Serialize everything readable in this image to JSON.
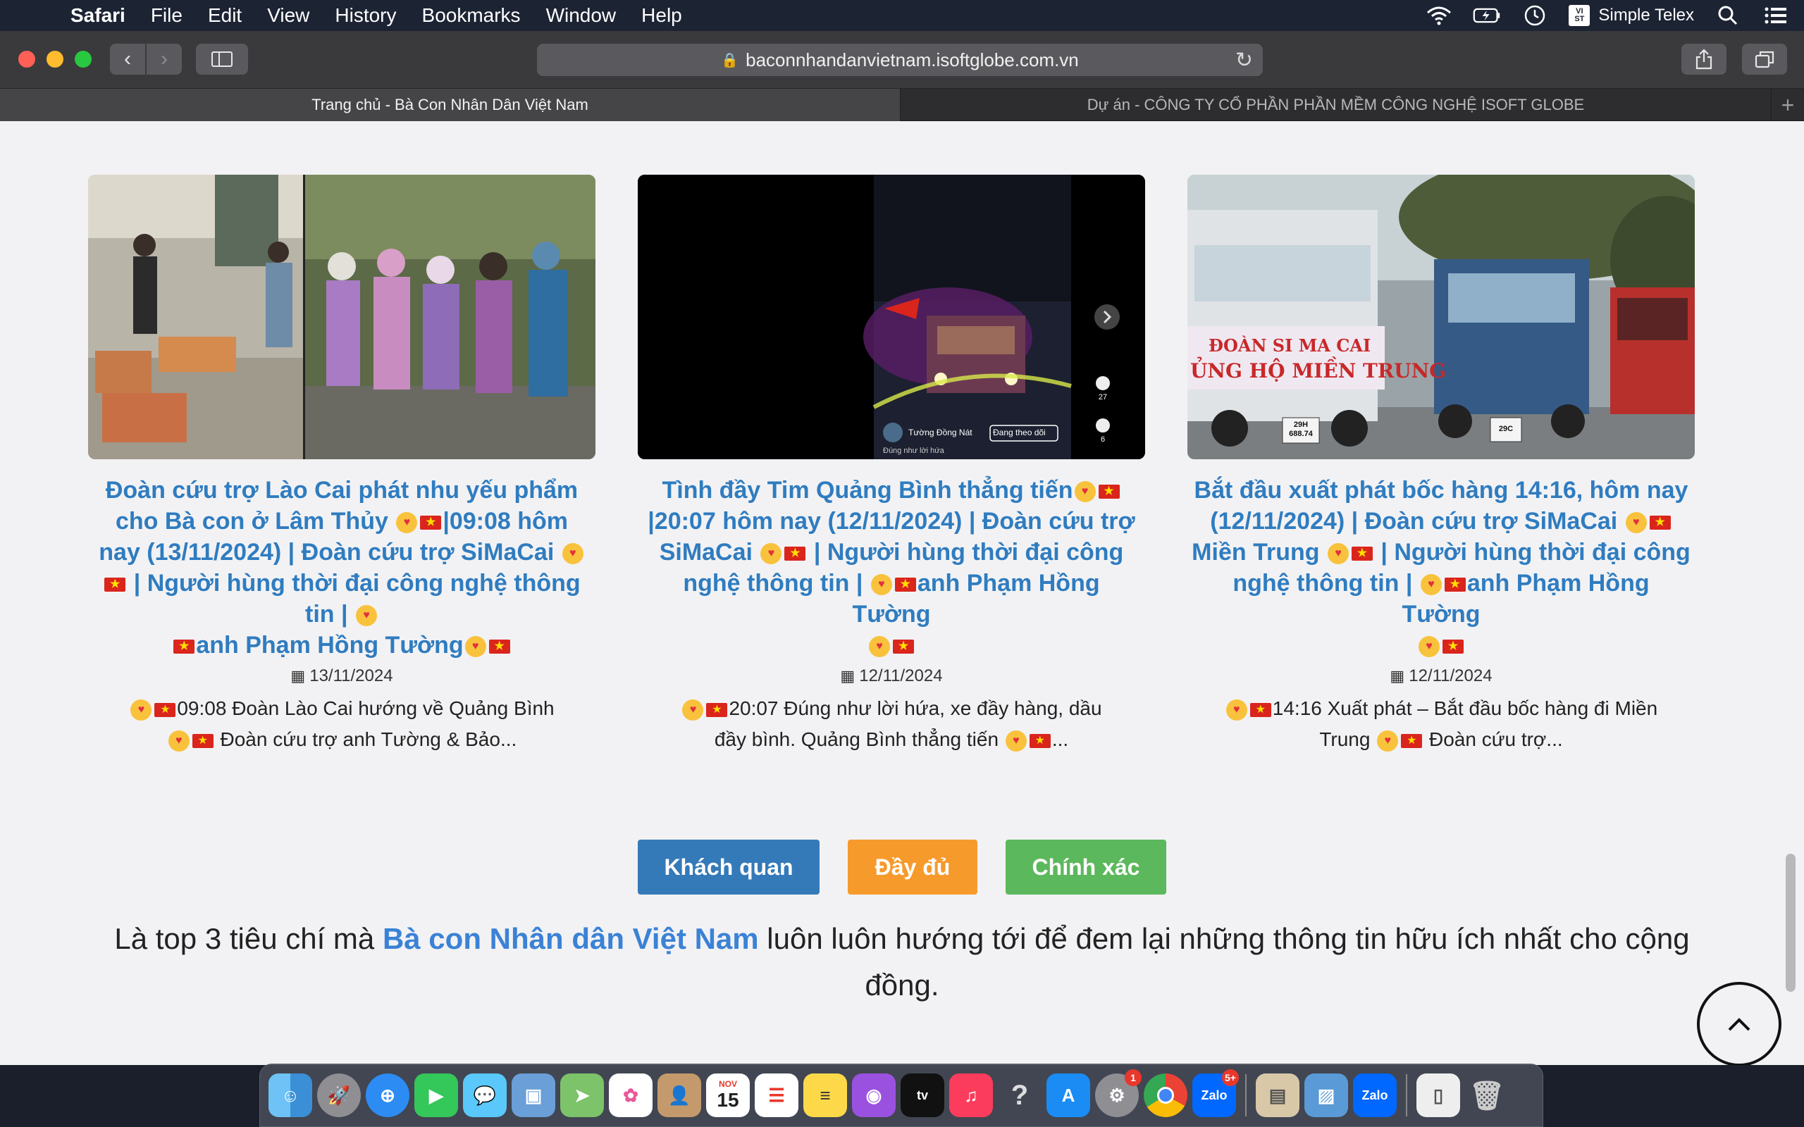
{
  "menubar": {
    "app_name": "Safari",
    "menus": [
      "File",
      "Edit",
      "View",
      "History",
      "Bookmarks",
      "Window",
      "Help"
    ],
    "status_right": {
      "input_source": "Simple Telex",
      "input_badge_top": "VI",
      "input_badge_bottom": "ST"
    }
  },
  "browser": {
    "url": "baconnhandanvietnam.isoftglobe.com.vn",
    "tabs": [
      {
        "label": "Trang chủ - Bà Con Nhân Dân Việt Nam",
        "active": true
      },
      {
        "label": "Dự án - CÔNG TY CỔ PHẦN PHẦN MỀM CÔNG NGHỆ ISOFT GLOBE",
        "active": false
      }
    ]
  },
  "posts": [
    {
      "title_parts": [
        "Đoàn cứu trợ Lào Cai phát nhu yếu phẩm cho Bà con ở Lâm Thủy ",
        "|09:08 hôm nay (13/11/2024) | Đoàn cứu trợ SiMaCai ",
        " | Người hùng thời đại công nghệ thông tin | ",
        "anh Phạm Hồng Tường"
      ],
      "date": "13/11/2024",
      "excerpt_parts": [
        "09:08 Đoàn Lào Cai hướng về Quảng Bình ",
        " Đoàn cứu trợ anh Tường & Bảo..."
      ]
    },
    {
      "title_parts": [
        "Tình đầy Tim Quảng Bình thẳng tiến",
        " |20:07 hôm nay (12/11/2024) | Đoàn cứu trợ SiMaCai ",
        " | Người hùng thời đại công nghệ thông tin | ",
        "anh Phạm Hồng Tường"
      ],
      "date": "12/11/2024",
      "excerpt_parts": [
        "20:07 Đúng như lời hứa, xe đầy hàng, dầu đầy bình. Quảng Bình thẳng tiến ",
        "..."
      ],
      "video_overlay": {
        "channel": "Tường Đồng Nát",
        "follow": "Đang theo dõi",
        "caption": "Đúng như lời hứa",
        "likes": "27",
        "comments": "6"
      }
    },
    {
      "title_parts": [
        "Bắt đầu xuất phát bốc hàng 14:16, hôm nay (12/11/2024) | Đoàn cứu trợ SiMaCai ",
        " Miền Trung ",
        " | Người hùng thời đại công nghệ thông tin | ",
        "anh Phạm Hồng Tường"
      ],
      "date": "12/11/2024",
      "excerpt_parts": [
        "14:16 Xuất phát – Bắt đầu bốc hàng đi Miền Trung ",
        " Đoàn cứu trợ..."
      ],
      "banner": {
        "line1": "ĐOÀN SI MA CAI",
        "line2": "ỦNG HỘ MIỀN TRUNG",
        "plate1": "29H 688.74",
        "plate2": "29C"
      }
    }
  ],
  "pillars": [
    "Khách quan",
    "Đầy đủ",
    "Chính xác"
  ],
  "tagline": {
    "before": "Là top 3 tiêu chí mà ",
    "brand": "Bà con Nhân dân Việt Nam",
    "after": " luôn luôn hướng tới để đem lại những thông tin hữu ích nhất cho cộng đồng."
  },
  "dock": {
    "apps": [
      "Finder",
      "Launchpad",
      "Safari",
      "FaceTime",
      "Messages",
      "Preview",
      "Maps",
      "Photos",
      "Contacts",
      "Calendar",
      "Reminders",
      "Notes",
      "Podcasts",
      "TV",
      "Music",
      "Help",
      "App Store",
      "System Preferences",
      "Chrome",
      "Zalo"
    ],
    "calendar_month": "NOV",
    "calendar_day": "15",
    "tv_label": "tv",
    "zalo_label": "Zalo",
    "prefs_badge": "1",
    "zalo_badge": "5+",
    "extra": [
      "Slides",
      "Screenshots",
      "Zalo",
      "Document",
      "Trash"
    ]
  },
  "colors": {
    "link_blue": "#2f7cc0",
    "brand_blue": "#3b82d6",
    "btn_blue": "#357ab8",
    "btn_orange": "#f79a2c",
    "btn_green": "#5cb85c"
  }
}
